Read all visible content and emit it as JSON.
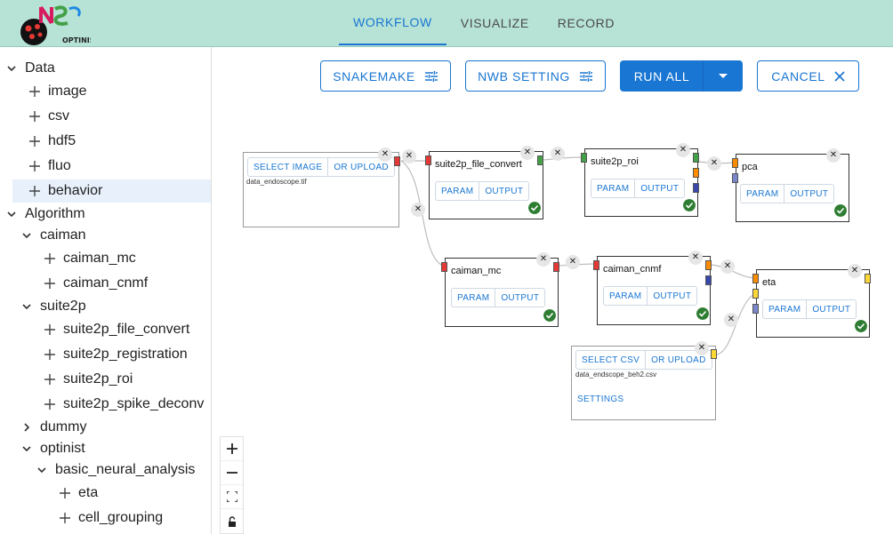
{
  "header": {
    "tabs": [
      {
        "label": "WORKFLOW",
        "active": true
      },
      {
        "label": "VISUALIZE",
        "active": false
      },
      {
        "label": "RECORD",
        "active": false
      }
    ],
    "logo_text": "OPTINIST"
  },
  "toolbar": {
    "snakemake_label": "SNAKEMAKE",
    "nwb_label": "NWB SETTING",
    "run_all_label": "RUN ALL",
    "cancel_label": "CANCEL"
  },
  "sidebar": {
    "data_label": "Data",
    "data_items": [
      "image",
      "csv",
      "hdf5",
      "fluo",
      "behavior"
    ],
    "algorithm_label": "Algorithm",
    "caiman_label": "caiman",
    "caiman_items": [
      "caiman_mc",
      "caiman_cnmf"
    ],
    "suite2p_label": "suite2p",
    "suite2p_items": [
      "suite2p_file_convert",
      "suite2p_registration",
      "suite2p_roi",
      "suite2p_spike_deconv"
    ],
    "dummy_label": "dummy",
    "optinist_label": "optinist",
    "basic_label": "basic_neural_analysis",
    "basic_items": [
      "eta",
      "cell_grouping"
    ]
  },
  "nodes": {
    "image_input": {
      "select_label": "SELECT IMAGE",
      "upload_label": "OR UPLOAD",
      "file": "data_endoscope.tif"
    },
    "csv_input": {
      "select_label": "SELECT CSV",
      "upload_label": "OR UPLOAD",
      "file": "data_endscope_beh2.csv",
      "settings_label": "SETTINGS"
    },
    "suite2p_file_convert": {
      "title": "suite2p_file_convert"
    },
    "suite2p_roi": {
      "title": "suite2p_roi"
    },
    "pca": {
      "title": "pca"
    },
    "caiman_mc": {
      "title": "caiman_mc"
    },
    "caiman_cnmf": {
      "title": "caiman_cnmf"
    },
    "eta": {
      "title": "eta"
    },
    "param_label": "PARAM",
    "output_label": "OUTPUT"
  },
  "colors": {
    "accent": "#1976d2",
    "header_bg": "#b7e3d6",
    "port_red": "#e53935",
    "port_green": "#43a047",
    "port_orange": "#fb8c00",
    "port_navy": "#3949ab",
    "port_yellow": "#fdd835",
    "port_lavender": "#7986cb",
    "success": "#2e7d32"
  },
  "icons": {
    "snakemake": "tune-icon",
    "nwb": "tune-icon",
    "run_dropdown": "caret-down-icon",
    "cancel": "close-icon",
    "zoom_in": "plus-icon",
    "zoom_out": "minus-icon",
    "fit": "fit-view-icon",
    "lock": "lock-icon"
  }
}
